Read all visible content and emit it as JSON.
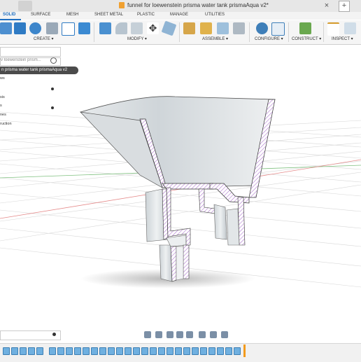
{
  "window": {
    "title": "funnel for loewenstein prisma water tank prismaAqua v2*",
    "close_glyph": "×",
    "add_glyph": "+"
  },
  "tabs": [
    {
      "label": "SOLID",
      "active": true
    },
    {
      "label": "SURFACE"
    },
    {
      "label": "MESH"
    },
    {
      "label": "SHEET METAL"
    },
    {
      "label": "PLASTIC"
    },
    {
      "label": "MANAGE"
    },
    {
      "label": "UTILITIES"
    }
  ],
  "toolbar": {
    "groups": [
      {
        "label": "CREATE ▾"
      },
      {
        "label": "MODIFY ▾"
      },
      {
        "label": "ASSEMBLE ▾"
      },
      {
        "label": "CONFIGURE ▾"
      },
      {
        "label": "CONSTRUCT ▾"
      },
      {
        "label": "INSPECT ▾"
      }
    ]
  },
  "browser": {
    "doc_row": "v loewenstein prism...",
    "active_component": "n prisma water tank prismaAqua v2",
    "items": [
      {
        "label": "ws"
      },
      {
        "label": "sis"
      },
      {
        "label": "s"
      },
      {
        "label": "nes"
      },
      {
        "label": "ruction"
      }
    ]
  },
  "colors": {
    "accent": "#1e6fc2",
    "timeline_marker": "#f29b1d",
    "section_hatch": "#c9a6d8"
  }
}
